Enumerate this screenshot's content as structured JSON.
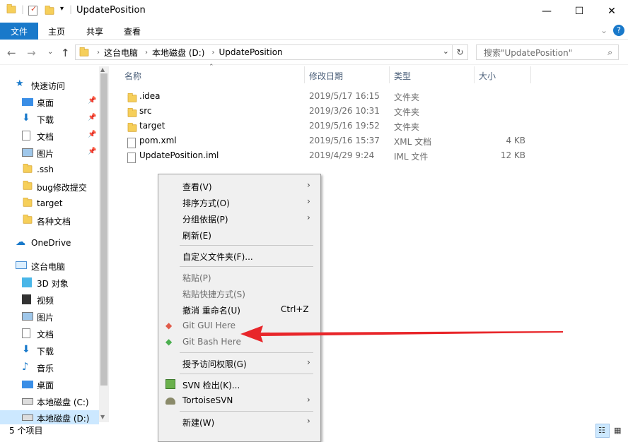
{
  "window": {
    "title": "UpdatePosition",
    "minimize": "—",
    "maximize": "☐",
    "close": "✕"
  },
  "ribbon": {
    "tabs": [
      "文件",
      "主页",
      "共享",
      "查看"
    ]
  },
  "address": {
    "segments": [
      "这台电脑",
      "本地磁盘 (D:)",
      "UpdatePosition"
    ],
    "search_placeholder": "搜索\"UpdatePosition\""
  },
  "sidebar": {
    "quick_access": "快速访问",
    "quick_items": [
      {
        "label": "桌面",
        "pinned": true
      },
      {
        "label": "下载",
        "pinned": true
      },
      {
        "label": "文档",
        "pinned": true
      },
      {
        "label": "图片",
        "pinned": true
      },
      {
        "label": ".ssh"
      },
      {
        "label": "bug修改提交"
      },
      {
        "label": "target"
      },
      {
        "label": "各种文档"
      }
    ],
    "onedrive": "OneDrive",
    "this_pc": "这台电脑",
    "pc_items": [
      "3D 对象",
      "视频",
      "图片",
      "文档",
      "下载",
      "音乐",
      "桌面",
      "本地磁盘 (C:)",
      "本地磁盘 (D:)"
    ]
  },
  "columns": {
    "name": "名称",
    "date": "修改日期",
    "type": "类型",
    "size": "大小"
  },
  "files": [
    {
      "name": ".idea",
      "date": "2019/5/17 16:15",
      "type": "文件夹",
      "size": "",
      "kind": "folder"
    },
    {
      "name": "src",
      "date": "2019/3/26 10:31",
      "type": "文件夹",
      "size": "",
      "kind": "folder"
    },
    {
      "name": "target",
      "date": "2019/5/16 19:52",
      "type": "文件夹",
      "size": "",
      "kind": "folder"
    },
    {
      "name": "pom.xml",
      "date": "2019/5/16 15:37",
      "type": "XML 文档",
      "size": "4 KB",
      "kind": "doc"
    },
    {
      "name": "UpdatePosition.iml",
      "date": "2019/4/29 9:24",
      "type": "IML 文件",
      "size": "12 KB",
      "kind": "doc"
    }
  ],
  "context_menu": {
    "view": "查看(V)",
    "sort": "排序方式(O)",
    "group": "分组依据(P)",
    "refresh": "刷新(E)",
    "customize": "自定义文件夹(F)...",
    "paste": "粘贴(P)",
    "paste_shortcut": "粘贴快捷方式(S)",
    "undo": "撤消 重命名(U)",
    "undo_key": "Ctrl+Z",
    "git_gui": "Git GUI Here",
    "git_bash": "Git Bash Here",
    "grant_access": "授予访问权限(G)",
    "svn_checkout": "SVN 检出(K)...",
    "tortoise": "TortoiseSVN",
    "new": "新建(W)"
  },
  "status": {
    "count": "5 个项目"
  },
  "colors": {
    "accent": "#1979ca",
    "arrow": "#e8262a",
    "selection": "#cce8ff"
  }
}
